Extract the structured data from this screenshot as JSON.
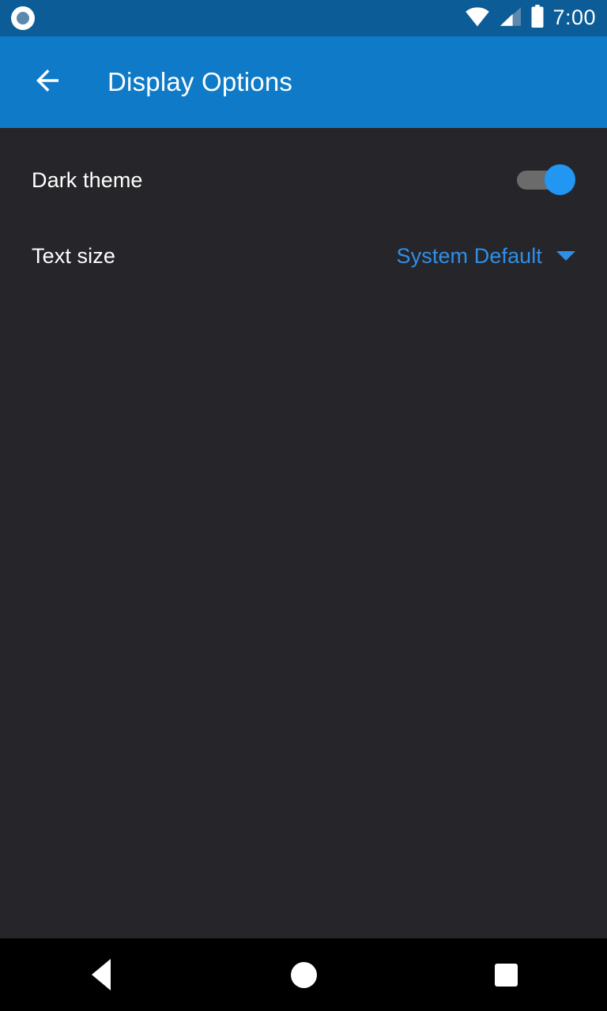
{
  "status_bar": {
    "notification_icon": "circle-notification-icon",
    "wifi_icon": "wifi-icon",
    "signal_icon": "cellular-signal-icon",
    "battery_icon": "battery-full-icon",
    "clock": "7:00",
    "background_color": "#0b5c97"
  },
  "app_bar": {
    "back_icon": "arrow-back-icon",
    "title": "Display Options",
    "background_color": "#0f7bc8",
    "title_color": "#ffffff"
  },
  "content": {
    "background_color": "#26262a",
    "preferences": [
      {
        "key": "dark_theme",
        "title": "Dark theme",
        "control": "switch",
        "checked": true,
        "track_color": "#6b6b6b",
        "thumb_color": "#2196f3"
      },
      {
        "key": "text_size",
        "title": "Text size",
        "control": "spinner",
        "value": "System Default",
        "value_color": "#2f8fe8",
        "caret_icon": "chevron-down-icon"
      }
    ]
  },
  "nav_bar": {
    "background_color": "#000000",
    "back_icon": "nav-back-triangle-icon",
    "home_icon": "nav-home-circle-icon",
    "recents_icon": "nav-recents-square-icon"
  }
}
